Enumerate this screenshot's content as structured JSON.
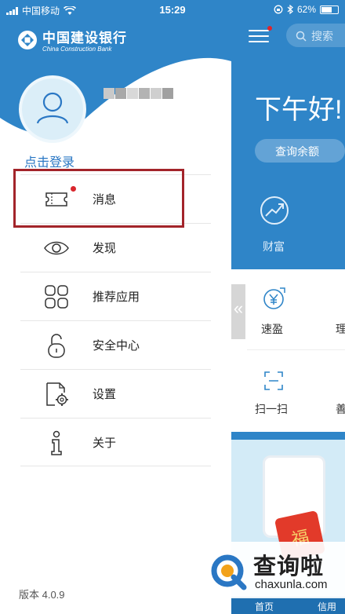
{
  "status_bar": {
    "carrier": "中国移动",
    "time": "15:29",
    "battery": "62%"
  },
  "background_screen": {
    "search_placeholder": "搜索",
    "greeting": "下午好!",
    "balance_button": "查询余额",
    "wealth_label": "财富",
    "quick_item": "速盈",
    "licai_partial": "理",
    "scan_label": "扫一扫",
    "shan_partial": "善",
    "collapse_glyph": "«",
    "fu_text": "福",
    "tab_home": "首页",
    "tab_credit": "信用"
  },
  "drawer": {
    "bank_name_cn": "中国建设银行",
    "bank_name_en": "China Construction Bank",
    "login_link": "点击登录",
    "menu": [
      {
        "label": "消息",
        "icon": "message-icon"
      },
      {
        "label": "发现",
        "icon": "eye-icon"
      },
      {
        "label": "推荐应用",
        "icon": "apps-grid-icon"
      },
      {
        "label": "安全中心",
        "icon": "lock-icon"
      },
      {
        "label": "设置",
        "icon": "settings-gear-icon"
      },
      {
        "label": "关于",
        "icon": "info-icon"
      }
    ],
    "version": "版本 4.0.9"
  },
  "watermark": {
    "cn": "查询啦",
    "en": "chaxunla.com"
  },
  "colors": {
    "brand_blue": "#2f85c8",
    "highlight_border": "#a3242a",
    "badge_red": "#d9262d",
    "login_blue": "#2a77c4"
  }
}
